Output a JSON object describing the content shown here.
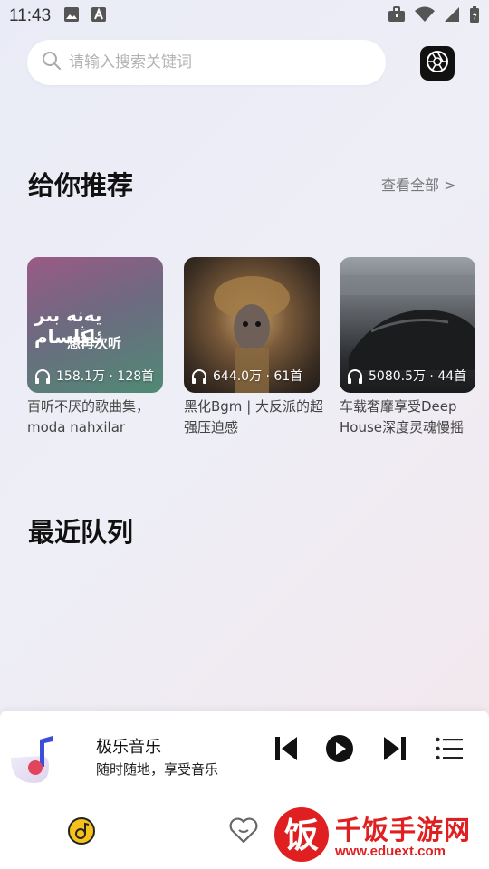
{
  "status_bar": {
    "time": "11:43"
  },
  "search": {
    "placeholder": "请输入搜索关键词"
  },
  "recommend": {
    "title": "给你推荐",
    "view_all": "查看全部 >",
    "cards": [
      {
        "stats": "158.1万 · 128首",
        "title": "百听不厌的歌曲集，moda nahxilar",
        "cover_text_1": "يەنە بىر ئاڭلسام",
        "cover_text_2": "想再次听"
      },
      {
        "stats": "644.0万 · 61首",
        "title": "黑化Bgm | 大反派的超强压迫感"
      },
      {
        "stats": "5080.5万 · 44首",
        "title": "车载奢靡享受Deep House深度灵魂慢摇"
      }
    ]
  },
  "recent": {
    "title": "最近队列"
  },
  "player": {
    "title": "极乐音乐",
    "subtitle": "随时随地，享受音乐"
  },
  "watermark": {
    "name": "千饭手游网",
    "url": "www.eduext.com",
    "logo_char": "饭"
  },
  "colors": {
    "accent": "#e02020",
    "nav_active": "#f0b400"
  }
}
